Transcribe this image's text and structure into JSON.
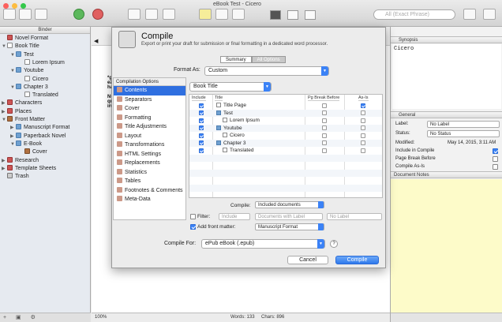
{
  "window": {
    "title": "eBook Test - Cicero",
    "search_placeholder": "All (Exact Phrase)"
  },
  "binder": {
    "header": "Binder",
    "items": [
      {
        "label": "Novel Format",
        "depth": 0,
        "icon": "book-icon",
        "tri": ""
      },
      {
        "label": "Book Title",
        "depth": 0,
        "icon": "document-icon",
        "tri": "▼"
      },
      {
        "label": "Test",
        "depth": 1,
        "icon": "folder-icon",
        "tri": "▼"
      },
      {
        "label": "Lorem Ipsum",
        "depth": 2,
        "icon": "document-icon",
        "tri": ""
      },
      {
        "label": "Youtube",
        "depth": 1,
        "icon": "folder-icon",
        "tri": "▼"
      },
      {
        "label": "Cicero",
        "depth": 2,
        "icon": "document-icon",
        "tri": ""
      },
      {
        "label": "Chapter 3",
        "depth": 1,
        "icon": "folder-icon",
        "tri": "▼"
      },
      {
        "label": "Translated",
        "depth": 2,
        "icon": "document-icon",
        "tri": ""
      },
      {
        "label": "Characters",
        "depth": 0,
        "icon": "characters-icon",
        "tri": "▶"
      },
      {
        "label": "Places",
        "depth": 0,
        "icon": "places-icon",
        "tri": "▶"
      },
      {
        "label": "Front Matter",
        "depth": 0,
        "icon": "front-matter-icon",
        "tri": "▼"
      },
      {
        "label": "Manuscript Format",
        "depth": 1,
        "icon": "folder-icon",
        "tri": "▶"
      },
      {
        "label": "Paperback Novel",
        "depth": 1,
        "icon": "folder-icon",
        "tri": "▶"
      },
      {
        "label": "E-Book",
        "depth": 1,
        "icon": "folder-icon",
        "tri": "▼"
      },
      {
        "label": "Cover",
        "depth": 2,
        "icon": "cover-icon",
        "tri": ""
      },
      {
        "label": "Research",
        "depth": 0,
        "icon": "research-icon",
        "tri": "▶"
      },
      {
        "label": "Template Sheets",
        "depth": 0,
        "icon": "template-icon",
        "tri": "▶"
      },
      {
        "label": "Trash",
        "depth": 0,
        "icon": "trash-icon",
        "tri": ""
      }
    ]
  },
  "editor": {
    "zoom": "100%",
    "words": "Words: 133",
    "chars": "Chars: 896",
    "stars_a": "*g",
    "stars_b": "eaq",
    "stars_c": "ha",
    "stars_d": "Nu",
    "stars_e": "quis",
    "stars_f": "irur"
  },
  "dialog": {
    "title": "Compile",
    "subtitle": "Export or print your draft for submission or final formatting in a dedicated word processor.",
    "tab_summary": "Summary",
    "tab_all_options": "All Options",
    "format_as_label": "Format As:",
    "format_as_value": "Custom",
    "options_header": "Compilation Options",
    "options": [
      "Contents",
      "Separators",
      "Cover",
      "Formatting",
      "Title Adjustments",
      "Layout",
      "Transformations",
      "HTML Settings",
      "Replacements",
      "Statistics",
      "Tables",
      "Footnotes & Comments",
      "Meta-Data"
    ],
    "selected_option": "Contents",
    "root_popup": "Book Title",
    "columns": {
      "include": "Include",
      "title": "Title",
      "pg_break": "Pg Break Before",
      "as_is": "As-Is"
    },
    "rows": [
      {
        "title": "Title Page",
        "indent": 0,
        "folder": false,
        "include": true,
        "pg_break": false,
        "as_is": true
      },
      {
        "title": "Test",
        "indent": 0,
        "folder": true,
        "include": true,
        "pg_break": false,
        "as_is": false
      },
      {
        "title": "Lorem Ipsum",
        "indent": 1,
        "folder": false,
        "include": true,
        "pg_break": false,
        "as_is": false
      },
      {
        "title": "Youtube",
        "indent": 0,
        "folder": true,
        "include": true,
        "pg_break": false,
        "as_is": false
      },
      {
        "title": "Cicero",
        "indent": 1,
        "folder": false,
        "include": true,
        "pg_break": false,
        "as_is": false
      },
      {
        "title": "Chapter 3",
        "indent": 0,
        "folder": true,
        "include": true,
        "pg_break": false,
        "as_is": false
      },
      {
        "title": "Translated",
        "indent": 1,
        "folder": false,
        "include": true,
        "pg_break": false,
        "as_is": false
      }
    ],
    "compile_label": "Compile:",
    "compile_value": "Included documents",
    "filter_label": "Filter:",
    "filter_mode": "Include",
    "filter_type": "Documents with Label",
    "filter_value": "No Label",
    "add_front_matter_label": "Add front matter:",
    "front_matter_value": "Manuscript Format",
    "compile_for_label": "Compile For:",
    "compile_for_value": "ePub eBook (.epub)",
    "help": "?",
    "cancel": "Cancel",
    "compile": "Compile"
  },
  "inspector": {
    "synopsis_header": "Synopsis",
    "synopsis_text": "Cicero",
    "general_header": "General",
    "label_label": "Label:",
    "label_value": "No Label",
    "status_label": "Status:",
    "status_value": "No Status",
    "modified_label": "Modified:",
    "modified_value": "May 14, 2015, 3:11 AM",
    "include_in_compile": "Include in Compile",
    "page_break_before": "Page Break Before",
    "compile_as_is": "Compile As-Is",
    "notes_header": "Document Notes"
  },
  "colors": {
    "accent": "#2f6fe0",
    "notes_bg": "#fdfbc9"
  }
}
